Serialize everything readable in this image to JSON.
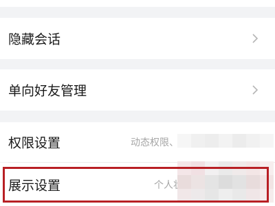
{
  "settings": {
    "items": [
      {
        "label": "隐藏会话",
        "value": ""
      },
      {
        "label": "单向好友管理",
        "value": ""
      },
      {
        "label": "权限设置",
        "value": "动态权限、"
      },
      {
        "label": "展示设置",
        "value": "个人状态"
      }
    ]
  },
  "highlight_color": "#b81f24",
  "icons": {
    "chevron": "chevron-right-icon"
  }
}
